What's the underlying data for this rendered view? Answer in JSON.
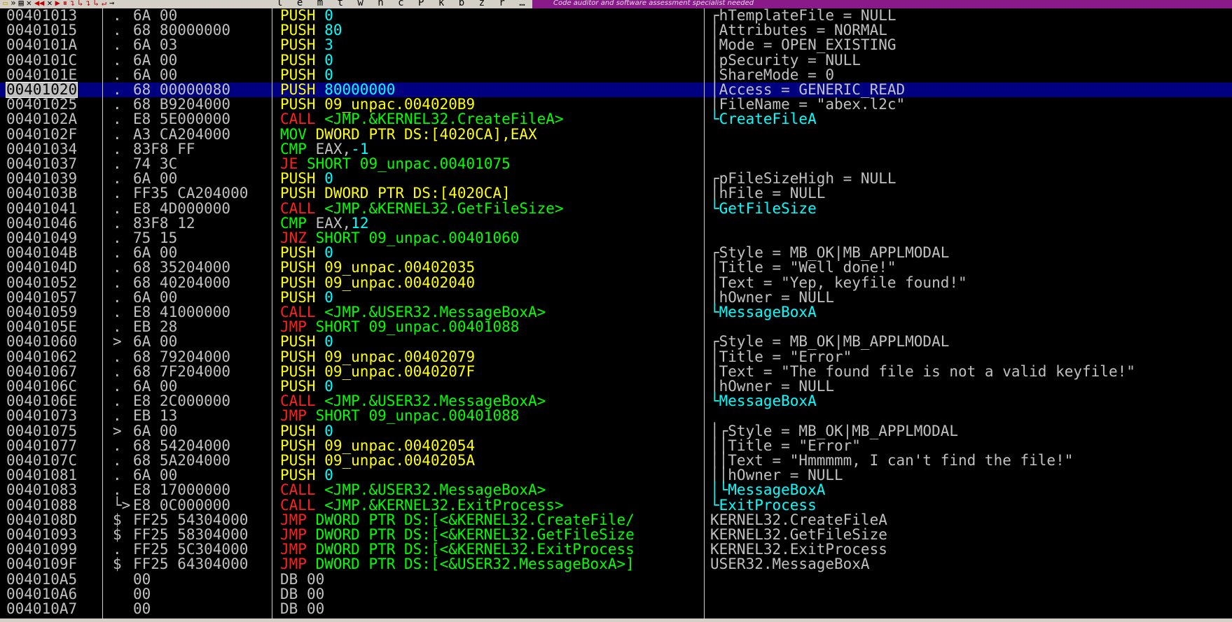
{
  "toolbar": {
    "icons": [
      "open-icon",
      "rewind-icon",
      "step-icon",
      "close-icon",
      "run-icon",
      "pause-icon",
      "step-into-icon",
      "step-over-icon",
      "trace-into-icon",
      "trace-over-icon",
      "execute-till-return-icon",
      "goto-icon"
    ],
    "letters": "l e m t w h c P k b z r … s",
    "help": "?",
    "banner": "Code auditor and software assessment specialist needed"
  },
  "selected_index": 5,
  "rows": [
    {
      "addr": "00401013",
      "mark": ".",
      "hex": "6A 00",
      "m": "PUSH",
      "mc": "push",
      "op": "0",
      "imm": true,
      "cmt": "┌hTemplateFile = NULL",
      "fn": false
    },
    {
      "addr": "00401015",
      "mark": ".",
      "hex": "68 80000000",
      "m": "PUSH",
      "mc": "push",
      "op": "80",
      "imm": true,
      "cmt": "│Attributes = NORMAL",
      "fn": false
    },
    {
      "addr": "0040101A",
      "mark": ".",
      "hex": "6A 03",
      "m": "PUSH",
      "mc": "push",
      "op": "3",
      "imm": true,
      "cmt": "│Mode = OPEN_EXISTING",
      "fn": false
    },
    {
      "addr": "0040101C",
      "mark": ".",
      "hex": "6A 00",
      "m": "PUSH",
      "mc": "push",
      "op": "0",
      "imm": true,
      "cmt": "│pSecurity = NULL",
      "fn": false
    },
    {
      "addr": "0040101E",
      "mark": ".",
      "hex": "6A 00",
      "m": "PUSH",
      "mc": "push",
      "op": "0",
      "imm": true,
      "cmt": "│ShareMode = 0",
      "fn": false
    },
    {
      "addr": "00401020",
      "mark": ".",
      "hex": "68 00000080",
      "m": "PUSH",
      "mc": "push",
      "op": "80000000",
      "imm": true,
      "cmt": "│Access = GENERIC_READ",
      "fn": false
    },
    {
      "addr": "00401025",
      "mark": ".",
      "hex": "68 B9204000",
      "m": "PUSH",
      "mc": "push",
      "op": "09_unpac.004020B9",
      "imm": false,
      "cmt": "│FileName = \"abex.l2c\"",
      "fn": false
    },
    {
      "addr": "0040102A",
      "mark": ".",
      "hex": "E8 5E000000",
      "m": "CALL",
      "mc": "call",
      "op": "<JMP.&KERNEL32.CreateFileA>",
      "imm": false,
      "cmt": "└CreateFileA",
      "fn": true
    },
    {
      "addr": "0040102F",
      "mark": ".",
      "hex": "A3 CA204000",
      "m": "MOV",
      "mc": "mov",
      "op": "DWORD PTR DS:[4020CA],EAX",
      "imm": false,
      "cmt": "",
      "fn": false
    },
    {
      "addr": "00401034",
      "mark": ".",
      "hex": "83F8 FF",
      "m": "CMP",
      "mc": "cmp",
      "op": "EAX,",
      "op2": "-1",
      "imm": false,
      "cmt": "",
      "fn": false
    },
    {
      "addr": "00401037",
      "mark": ".",
      "hex": "74 3C",
      "m": "JE",
      "mc": "jcc",
      "op": "SHORT 09_unpac.00401075",
      "imm": false,
      "cmt": "",
      "fn": false
    },
    {
      "addr": "00401039",
      "mark": ".",
      "hex": "6A 00",
      "m": "PUSH",
      "mc": "push",
      "op": "0",
      "imm": true,
      "cmt": "┌pFileSizeHigh = NULL",
      "fn": false
    },
    {
      "addr": "0040103B",
      "mark": ".",
      "hex": "FF35 CA204000",
      "m": "PUSH",
      "mc": "push",
      "op": "DWORD PTR DS:[4020CA]",
      "imm": false,
      "cmt": "│hFile = NULL",
      "fn": false
    },
    {
      "addr": "00401041",
      "mark": ".",
      "hex": "E8 4D000000",
      "m": "CALL",
      "mc": "call",
      "op": "<JMP.&KERNEL32.GetFileSize>",
      "imm": false,
      "cmt": "└GetFileSize",
      "fn": true
    },
    {
      "addr": "00401046",
      "mark": ".",
      "hex": "83F8 12",
      "m": "CMP",
      "mc": "cmp",
      "op": "EAX,",
      "op2": "12",
      "imm": false,
      "cmt": "",
      "fn": false
    },
    {
      "addr": "00401049",
      "mark": ".",
      "hex": "75 15",
      "m": "JNZ",
      "mc": "jcc",
      "op": "SHORT 09_unpac.00401060",
      "imm": false,
      "cmt": "",
      "fn": false
    },
    {
      "addr": "0040104B",
      "mark": ".",
      "hex": "6A 00",
      "m": "PUSH",
      "mc": "push",
      "op": "0",
      "imm": true,
      "cmt": "┌Style = MB_OK|MB_APPLMODAL",
      "fn": false
    },
    {
      "addr": "0040104D",
      "mark": ".",
      "hex": "68 35204000",
      "m": "PUSH",
      "mc": "push",
      "op": "09_unpac.00402035",
      "imm": false,
      "cmt": "│Title = \"Well done!\"",
      "fn": false
    },
    {
      "addr": "00401052",
      "mark": ".",
      "hex": "68 40204000",
      "m": "PUSH",
      "mc": "push",
      "op": "09_unpac.00402040",
      "imm": false,
      "cmt": "│Text = \"Yep, keyfile found!\"",
      "fn": false
    },
    {
      "addr": "00401057",
      "mark": ".",
      "hex": "6A 00",
      "m": "PUSH",
      "mc": "push",
      "op": "0",
      "imm": true,
      "cmt": "│hOwner = NULL",
      "fn": false
    },
    {
      "addr": "00401059",
      "mark": ".",
      "hex": "E8 41000000",
      "m": "CALL",
      "mc": "call",
      "op": "<JMP.&USER32.MessageBoxA>",
      "imm": false,
      "cmt": "└MessageBoxA",
      "fn": true
    },
    {
      "addr": "0040105E",
      "mark": ".",
      "hex": "EB 28",
      "m": "JMP",
      "mc": "jmp",
      "op": "SHORT 09_unpac.00401088",
      "imm": false,
      "cmt": "",
      "fn": false
    },
    {
      "addr": "00401060",
      "mark": ">",
      "hex": "6A 00",
      "m": "PUSH",
      "mc": "push",
      "op": "0",
      "imm": true,
      "cmt": "┌Style = MB_OK|MB_APPLMODAL",
      "fn": false
    },
    {
      "addr": "00401062",
      "mark": ".",
      "hex": "68 79204000",
      "m": "PUSH",
      "mc": "push",
      "op": "09_unpac.00402079",
      "imm": false,
      "cmt": "│Title = \"Error\"",
      "fn": false
    },
    {
      "addr": "00401067",
      "mark": ".",
      "hex": "68 7F204000",
      "m": "PUSH",
      "mc": "push",
      "op": "09_unpac.0040207F",
      "imm": false,
      "cmt": "│Text = \"The found file is not a valid keyfile!\"",
      "fn": false
    },
    {
      "addr": "0040106C",
      "mark": ".",
      "hex": "6A 00",
      "m": "PUSH",
      "mc": "push",
      "op": "0",
      "imm": true,
      "cmt": "│hOwner = NULL",
      "fn": false
    },
    {
      "addr": "0040106E",
      "mark": ".",
      "hex": "E8 2C000000",
      "m": "CALL",
      "mc": "call",
      "op": "<JMP.&USER32.MessageBoxA>",
      "imm": false,
      "cmt": "└MessageBoxA",
      "fn": true
    },
    {
      "addr": "00401073",
      "mark": ".",
      "hex": "EB 13",
      "m": "JMP",
      "mc": "jmp",
      "op": "SHORT 09_unpac.00401088",
      "imm": false,
      "cmt": "",
      "fn": false
    },
    {
      "addr": "00401075",
      "mark": ">",
      "hex": "6A 00",
      "m": "PUSH",
      "mc": "push",
      "op": "0",
      "imm": true,
      "cmt": "│┌Style = MB_OK|MB_APPLMODAL",
      "fn": false
    },
    {
      "addr": "00401077",
      "mark": ".",
      "hex": "68 54204000",
      "m": "PUSH",
      "mc": "push",
      "op": "09_unpac.00402054",
      "imm": false,
      "cmt": "││Title = \"Error\"",
      "fn": false
    },
    {
      "addr": "0040107C",
      "mark": ".",
      "hex": "68 5A204000",
      "m": "PUSH",
      "mc": "push",
      "op": "09_unpac.0040205A",
      "imm": false,
      "cmt": "││Text = \"Hmmmmm, I can't find the file!\"",
      "fn": false
    },
    {
      "addr": "00401081",
      "mark": ".",
      "hex": "6A 00",
      "m": "PUSH",
      "mc": "push",
      "op": "0",
      "imm": true,
      "cmt": "││hOwner = NULL",
      "fn": false
    },
    {
      "addr": "00401083",
      "mark": ".",
      "hex": "E8 17000000",
      "m": "CALL",
      "mc": "call",
      "op": "<JMP.&USER32.MessageBoxA>",
      "imm": false,
      "cmt": "│└MessageBoxA",
      "fn": true
    },
    {
      "addr": "00401088",
      "mark": "└>",
      "hex": "E8 0C000000",
      "m": "CALL",
      "mc": "call",
      "op": "<JMP.&KERNEL32.ExitProcess>",
      "imm": false,
      "cmt": "└ExitProcess",
      "fn": true
    },
    {
      "addr": "0040108D",
      "mark": "$",
      "hex": "FF25 54304000",
      "m": "JMP",
      "mc": "jmp",
      "op": "DWORD PTR DS:[<&KERNEL32.CreateFile/",
      "imm": false,
      "cmt": "KERNEL32.CreateFileA",
      "fn": false
    },
    {
      "addr": "00401093",
      "mark": "$",
      "hex": "FF25 58304000",
      "m": "JMP",
      "mc": "jmp",
      "op": "DWORD PTR DS:[<&KERNEL32.GetFileSize",
      "imm": false,
      "cmt": "KERNEL32.GetFileSize",
      "fn": false
    },
    {
      "addr": "00401099",
      "mark": ".",
      "hex": "FF25 5C304000",
      "m": "JMP",
      "mc": "jmp",
      "op": "DWORD PTR DS:[<&KERNEL32.ExitProcess",
      "imm": false,
      "cmt": "KERNEL32.ExitProcess",
      "fn": false
    },
    {
      "addr": "0040109F",
      "mark": "$",
      "hex": "FF25 64304000",
      "m": "JMP",
      "mc": "jmp",
      "op": "DWORD PTR DS:[<&USER32.MessageBoxA>]",
      "imm": false,
      "cmt": "USER32.MessageBoxA",
      "fn": false
    },
    {
      "addr": "004010A5",
      "mark": "",
      "hex": "00",
      "m": "DB",
      "mc": "db",
      "op": "00",
      "imm": false,
      "cmt": "",
      "fn": false
    },
    {
      "addr": "004010A6",
      "mark": "",
      "hex": "00",
      "m": "DB",
      "mc": "db",
      "op": "00",
      "imm": false,
      "cmt": "",
      "fn": false
    },
    {
      "addr": "004010A7",
      "mark": "",
      "hex": "00",
      "m": "DB",
      "mc": "db",
      "op": "00",
      "imm": false,
      "cmt": "",
      "fn": false
    }
  ]
}
